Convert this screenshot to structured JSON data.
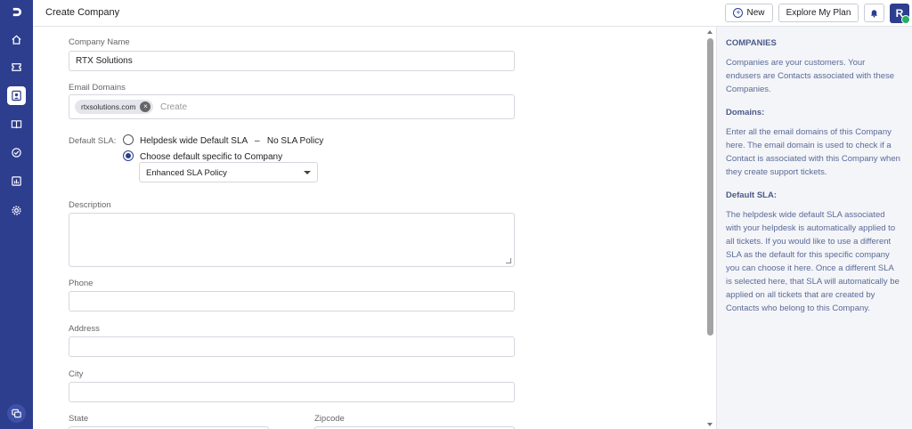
{
  "header": {
    "title": "Create Company",
    "new_label": "New",
    "plan_label": "Explore My Plan",
    "avatar_initial": "R"
  },
  "form": {
    "company_name_label": "Company Name",
    "company_name_value": "RTX Solutions",
    "email_domains_label": "Email Domains",
    "email_domain_chip": "rtxsolutions.com",
    "email_domains_placeholder": "Create",
    "default_sla_label": "Default SLA:",
    "sla_option_default": "Helpdesk wide Default SLA   –   No SLA Policy",
    "sla_option_specific": "Choose default specific to Company",
    "sla_selected_policy": "Enhanced SLA Policy",
    "description_label": "Description",
    "phone_label": "Phone",
    "address_label": "Address",
    "city_label": "City",
    "state_label": "State",
    "zipcode_label": "Zipcode"
  },
  "help": {
    "companies_title": "COMPANIES",
    "companies_text": "Companies are your customers. Your endusers are Contacts associated with these Companies.",
    "domains_title": "Domains:",
    "domains_text": "Enter all the email domains of this Company here. The email domain is used to check if a Contact is associated with this Company when they create support tickets.",
    "sla_title": "Default SLA:",
    "sla_text": "The helpdesk wide default SLA associated with your helpdesk is automatically applied to all tickets. If you would like to use a different SLA as the default for this specific company you can choose it here. Once a different SLA is selected here, that SLA will automatically be applied on all tickets that are created by Contacts who belong to this Company."
  },
  "colors": {
    "sidebar": "#2d3e8f",
    "accent": "#2d3e8f",
    "success": "#27ae60"
  }
}
